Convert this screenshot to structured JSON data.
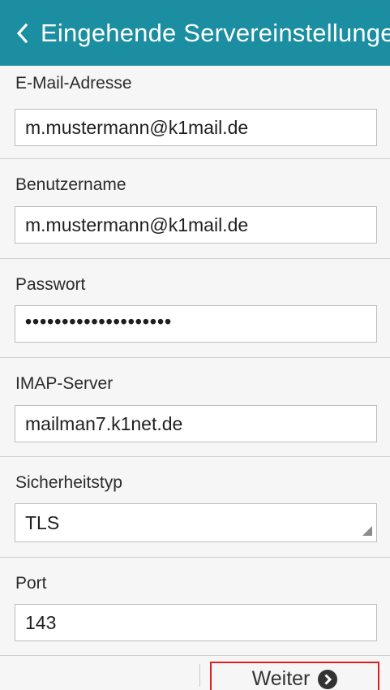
{
  "header": {
    "title": "Eingehende Servereinstellungen",
    "back_icon": "chevron-left-icon",
    "background_color": "#1b8ea2"
  },
  "form": {
    "email": {
      "label": "E-Mail-Adresse",
      "value": "m.mustermann@k1mail.de"
    },
    "username": {
      "label": "Benutzername",
      "value": "m.mustermann@k1mail.de"
    },
    "password": {
      "label": "Passwort",
      "value": "••••••••••••••••••••"
    },
    "imap_server": {
      "label": "IMAP-Server",
      "value": "mailman7.k1net.de"
    },
    "security_type": {
      "label": "Sicherheitstyp",
      "value": "TLS"
    },
    "port": {
      "label": "Port",
      "value": "143"
    }
  },
  "footer": {
    "next_label": "Weiter",
    "next_icon": "chevron-right-circle-icon",
    "highlight_color": "#e02020"
  }
}
